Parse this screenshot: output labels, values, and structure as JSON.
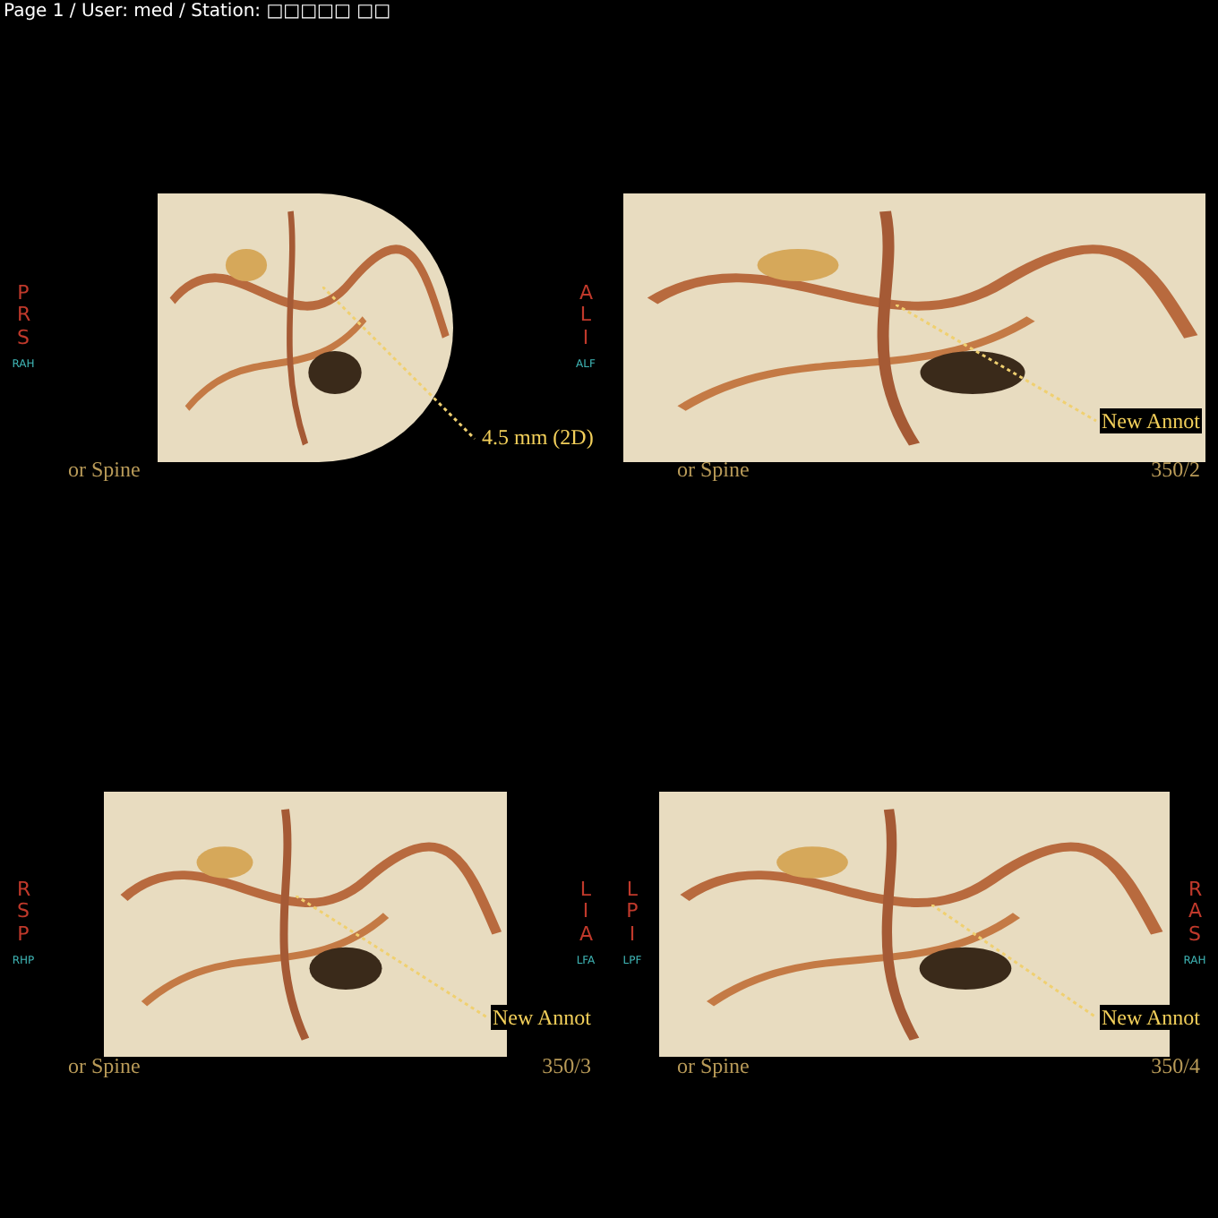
{
  "header": "Page 1 / User: med / Station: □□□□□ □□",
  "viewports": [
    {
      "left_orientation": "PRS",
      "left_sub": "RAH",
      "right_orientation": "ALI",
      "right_sub": "ALF",
      "annotation": "4.5 mm (2D)",
      "caption": "or Spine"
    },
    {
      "annotation": "New Annot",
      "caption": "or Spine",
      "frame": "350/2"
    },
    {
      "left_orientation": "RSP",
      "left_sub": "RHP",
      "right_orientation": "LIA",
      "right_sub": "LFA",
      "annotation": "New Annot",
      "caption": "or Spine",
      "frame": "350/3"
    },
    {
      "left_orientation": "LPI",
      "left_sub": "LPF",
      "right_orientation": "RAS",
      "right_sub": "RAH",
      "annotation": "New Annot",
      "caption": "or Spine",
      "frame": "350/4"
    }
  ]
}
